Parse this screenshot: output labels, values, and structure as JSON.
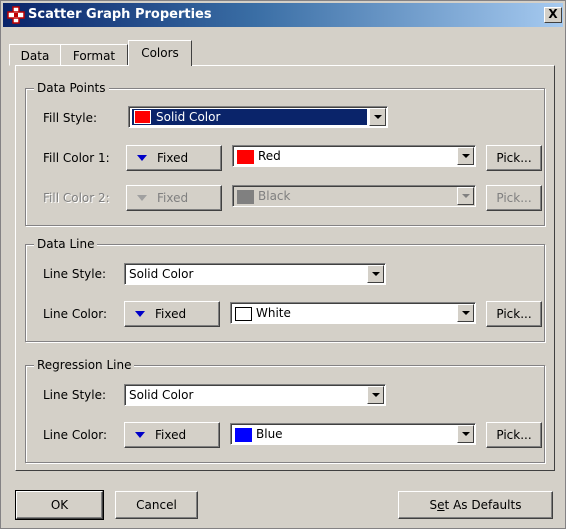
{
  "window": {
    "title": "Scatter Graph Properties",
    "close_symbol": "X"
  },
  "tabs": [
    {
      "label": "Data"
    },
    {
      "label": "Format"
    },
    {
      "label": "Colors",
      "active": true
    }
  ],
  "data_points": {
    "legend": "Data Points",
    "fill_style_label": "Fill Style:",
    "fill_style_value": "Solid Color",
    "fill_style_swatch": "#ff0000",
    "fill_color1_label": "Fill Color 1:",
    "fill_color1_mode": "Fixed",
    "fill_color1_value": "Red",
    "fill_color1_swatch": "#ff0000",
    "fill_color1_pick": "Pick...",
    "fill_color2_label": "Fill Color 2:",
    "fill_color2_mode": "Fixed",
    "fill_color2_value": "Black",
    "fill_color2_swatch": "#808080",
    "fill_color2_pick": "Pick..."
  },
  "data_line": {
    "legend": "Data Line",
    "line_style_label": "Line Style:",
    "line_style_value": "Solid Color",
    "line_color_label": "Line Color:",
    "line_color_mode": "Fixed",
    "line_color_value": "White",
    "line_color_swatch": "#ffffff",
    "line_color_pick": "Pick..."
  },
  "regression_line": {
    "legend": "Regression Line",
    "line_style_label": "Line Style:",
    "line_style_value": "Solid Color",
    "line_color_label": "Line Color:",
    "line_color_mode": "Fixed",
    "line_color_value": "Blue",
    "line_color_swatch": "#0000ff",
    "line_color_pick": "Pick..."
  },
  "buttons": {
    "ok": "OK",
    "cancel": "Cancel",
    "set_defaults_prefix": "S",
    "set_defaults_u": "e",
    "set_defaults_rest": "t As Defaults"
  }
}
